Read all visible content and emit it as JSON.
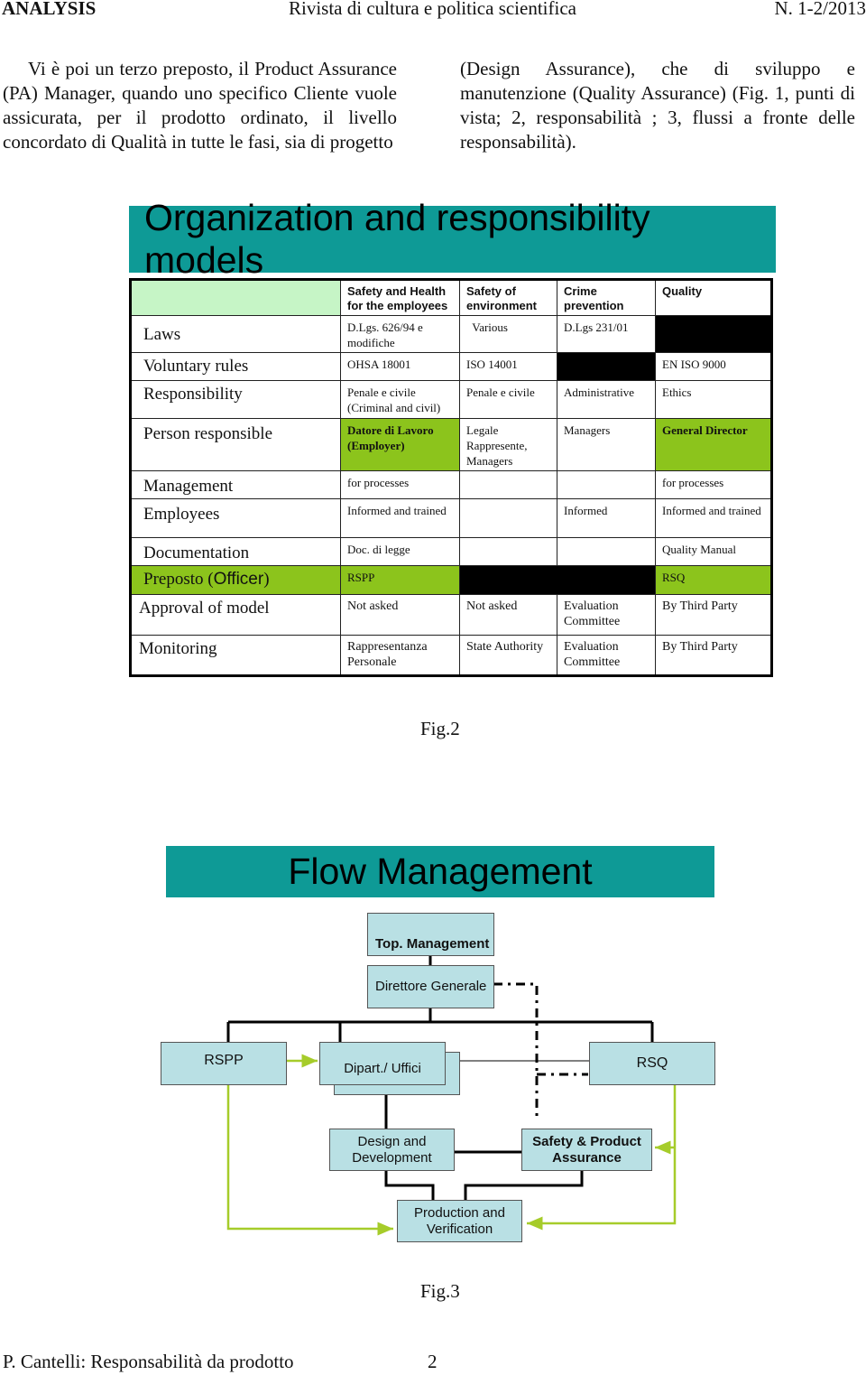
{
  "header": {
    "journal": "ANALYSIS",
    "subtitle": "Rivista di cultura e politica scientifica",
    "issue": "N. 1-2/2013"
  },
  "body_text": {
    "left_column": "Vi è poi un terzo preposto, il Product Assurance (PA) Manager, quando uno specifico Cliente vuole assicurata, per il prodotto ordinato, il livello concordato di Qualità in tutte le fasi, sia di progetto",
    "right_column": "(Design Assurance), che di sviluppo e manutenzione (Quality Assurance) (Fig. 1, punti di vista; 2, responsabilità ; 3, flussi a fronte delle responsabilità)."
  },
  "figure2": {
    "title": "Organization and responsibility models",
    "columns": [
      "Safety and Health for the employees",
      "Safety of environment",
      "Crime prevention",
      "Quality"
    ],
    "rows": [
      {
        "label": "Laws",
        "cells": [
          "D.Lgs. 626/94 e modifiche",
          "  Various",
          "D.Lgs 231/01",
          ""
        ]
      },
      {
        "label": "Voluntary rules",
        "cells": [
          "OHSA 18001",
          "ISO 14001",
          "",
          "EN ISO 9000"
        ]
      },
      {
        "label": "Responsibility",
        "cells": [
          "Penale e civile (Criminal and civil)",
          "Penale e civile",
          "Administrative",
          "Ethics"
        ]
      },
      {
        "label": "Person  responsible",
        "cells": [
          "Datore di Lavoro (Employer)",
          "Legale Rappresente, Managers",
          "Managers",
          "General  Director"
        ]
      },
      {
        "label": "Management",
        "cells": [
          "for  processes",
          "",
          "",
          "for  processes"
        ]
      },
      {
        "label": "Employees",
        "cells": [
          "Informed and trained",
          "",
          "Informed",
          "Informed and trained"
        ]
      },
      {
        "label": "Documentation",
        "cells": [
          "Doc. di legge",
          "",
          "",
          "Quality Manual"
        ]
      },
      {
        "label_prefix": "Preposto (",
        "label_sans": "Officer",
        "label_suffix": ")",
        "cells": [
          "RSPP",
          "",
          "",
          "RSQ"
        ]
      },
      {
        "label": "Approval of model",
        "cells": [
          "Not asked",
          "Not asked",
          "Evaluation Committee",
          "By Third Party"
        ]
      },
      {
        "label": "Monitoring",
        "cells": [
          "Rappresentanza Personale",
          "State Authority",
          "Evaluation Committee",
          "By Third Party"
        ]
      }
    ],
    "colors": {
      "teal": "#0e9a96",
      "green": "#8cc41c",
      "light_green": "#c6f5c6",
      "black": "#000000"
    },
    "caption": "Fig.2"
  },
  "figure3": {
    "title": "Flow Management",
    "nodes": {
      "top_management": "Top. Management",
      "direttore": "Direttore Generale",
      "rspp": "RSPP",
      "dipart": "Dipart./ Uffici",
      "rsq": "RSQ",
      "design": "Design and Development",
      "safety": "Safety & Product Assurance",
      "production": "Production and Verification"
    },
    "colors": {
      "box": "#b9e0e4",
      "green_link": "#a6cc2a"
    },
    "caption": "Fig.3"
  },
  "footer": {
    "author_title": "P. Cantelli: Responsabilità da prodotto",
    "page_number": "2"
  }
}
